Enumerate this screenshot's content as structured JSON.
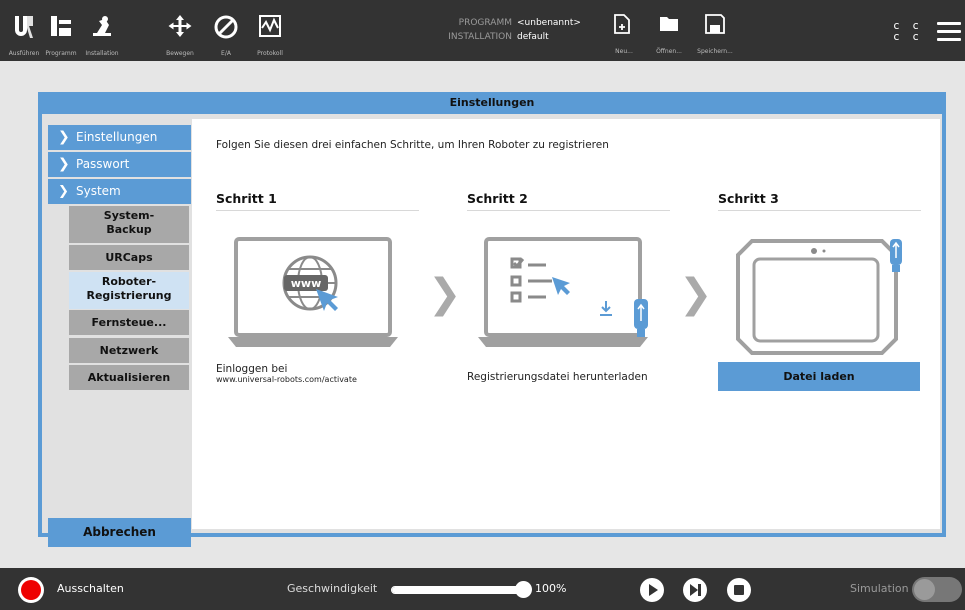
{
  "topbar": {
    "nav": [
      {
        "label": "Ausführen",
        "icon": "ur-logo-icon"
      },
      {
        "label": "Programm",
        "icon": "program-icon"
      },
      {
        "label": "Installation",
        "icon": "installation-icon"
      },
      {
        "label": "Bewegen",
        "icon": "move-icon"
      },
      {
        "label": "E/A",
        "icon": "io-icon"
      },
      {
        "label": "Protokoll",
        "icon": "log-icon"
      }
    ],
    "program_label": "PROGRAMM",
    "program_value": "<unbenannt>",
    "installation_label": "INSTALLATION",
    "installation_value": "default",
    "file_actions": [
      {
        "label": "Neu...",
        "icon": "new-file-icon"
      },
      {
        "label": "Öffnen...",
        "icon": "folder-icon"
      },
      {
        "label": "Speichern...",
        "icon": "save-icon"
      }
    ],
    "cc_line1": "c c",
    "cc_line2": "c c"
  },
  "dialog": {
    "title": "Einstellungen",
    "sidebar": {
      "items": [
        {
          "label": "Einstellungen",
          "chevron": ">"
        },
        {
          "label": "Passwort",
          "chevron": ">"
        },
        {
          "label": "System",
          "chevron": "v"
        }
      ],
      "sub_items": [
        {
          "label": "System-\nBackup",
          "selected": false
        },
        {
          "label": "URCaps",
          "selected": false
        },
        {
          "label": "Roboter-\nRegistrierung",
          "selected": true
        },
        {
          "label": "Fernsteue...",
          "selected": false
        },
        {
          "label": "Netzwerk",
          "selected": false
        },
        {
          "label": "Aktualisieren",
          "selected": false
        }
      ],
      "cancel_label": "Abbrechen"
    },
    "content": {
      "intro": "Folgen Sie diesen drei einfachen Schritte, um Ihren Roboter zu registrieren",
      "steps": [
        {
          "title": "Schritt 1",
          "caption": "Einloggen bei",
          "url": "www.universal-robots.com/activate",
          "www": "www"
        },
        {
          "title": "Schritt 2",
          "caption": "Registrierungsdatei herunterladen"
        },
        {
          "title": "Schritt 3",
          "button": "Datei laden"
        }
      ]
    }
  },
  "bottombar": {
    "power_label": "Ausschalten",
    "speed_label": "Geschwindigkeit",
    "speed_value": "100%",
    "speed_fraction": 1.0,
    "simulation_label": "Simulation",
    "simulation_on": false
  },
  "colors": {
    "accent": "#5b9bd5",
    "bar": "#333333",
    "power": "#ee0000"
  }
}
